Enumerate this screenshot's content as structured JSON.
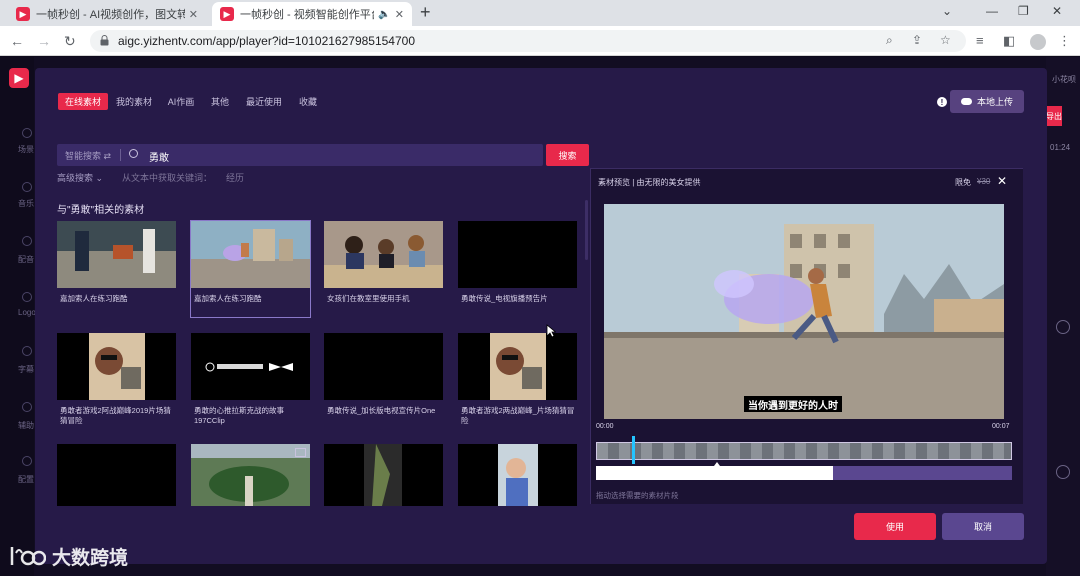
{
  "browser": {
    "tabs": [
      {
        "title": "一帧秒创 - AI视频创作，图文转视频"
      },
      {
        "title": "一帧秒创 - 视频智能创作平台"
      }
    ],
    "url": "aigc.yizhentv.com/app/player?id=101021627985154700",
    "tab_close": "✕",
    "new_tab": "+"
  },
  "app": {
    "rail_items": [
      "场景",
      "音乐",
      "配音",
      "Logo",
      "字幕",
      "辅助",
      "配置"
    ],
    "right_edge": {
      "label_top": "小花呗",
      "red_label": "导出",
      "time": "01:24"
    }
  },
  "modal": {
    "category_tabs": [
      {
        "label": "在线素材",
        "active": true
      },
      {
        "label": "我的素材",
        "active": false
      },
      {
        "label": "AI作画",
        "active": false
      },
      {
        "label": "其他",
        "active": false
      },
      {
        "label": "最近使用",
        "active": false
      },
      {
        "label": "收藏",
        "active": false
      }
    ],
    "upload_label": "本地上传",
    "search": {
      "mode": "智能搜索",
      "mode_swap": "⇄",
      "query": "勇敢",
      "button": "搜索"
    },
    "advanced": "高级搜索",
    "keyword_label": "从文本中获取关键词：",
    "keyword_value": "经历",
    "related_title": "与\"勇敢\"相关的素材",
    "results": [
      {
        "caption": "嘉加索人在练习跑酷"
      },
      {
        "caption": "嘉加索人在练习跑酷"
      },
      {
        "caption": "女孩们在教室里使用手机"
      },
      {
        "caption": "勇敢传说_电视旗播预告片"
      },
      {
        "caption": "勇敢者游戏2阿战巅峰2019片场猜猜冒险"
      },
      {
        "caption": "勇敢的心推拉斯克战的故事197CClip"
      },
      {
        "caption": "勇敢传说_加长版电视宣传片One"
      },
      {
        "caption": "勇敢者游戏2两战巅峰_片场猜猜冒险"
      },
      {
        "caption": ""
      },
      {
        "caption": ""
      },
      {
        "caption": ""
      },
      {
        "caption": ""
      }
    ],
    "preview": {
      "title": "素材预览 | 由无限的美女提供",
      "free": "限免",
      "price": "¥30",
      "close": "✕",
      "subtitle": "当你遇到更好的人时",
      "time_start": "00:00",
      "time_end": "00:07",
      "range_fraction": 0.57,
      "hint": "拖动选择需要的素材片段"
    },
    "use_button": "使用",
    "cancel_button": "取消"
  },
  "watermark": "大数跨境",
  "colors": {
    "accent": "#e8294b",
    "modal_bg": "#261a48",
    "secondary_button": "#5a4790"
  }
}
